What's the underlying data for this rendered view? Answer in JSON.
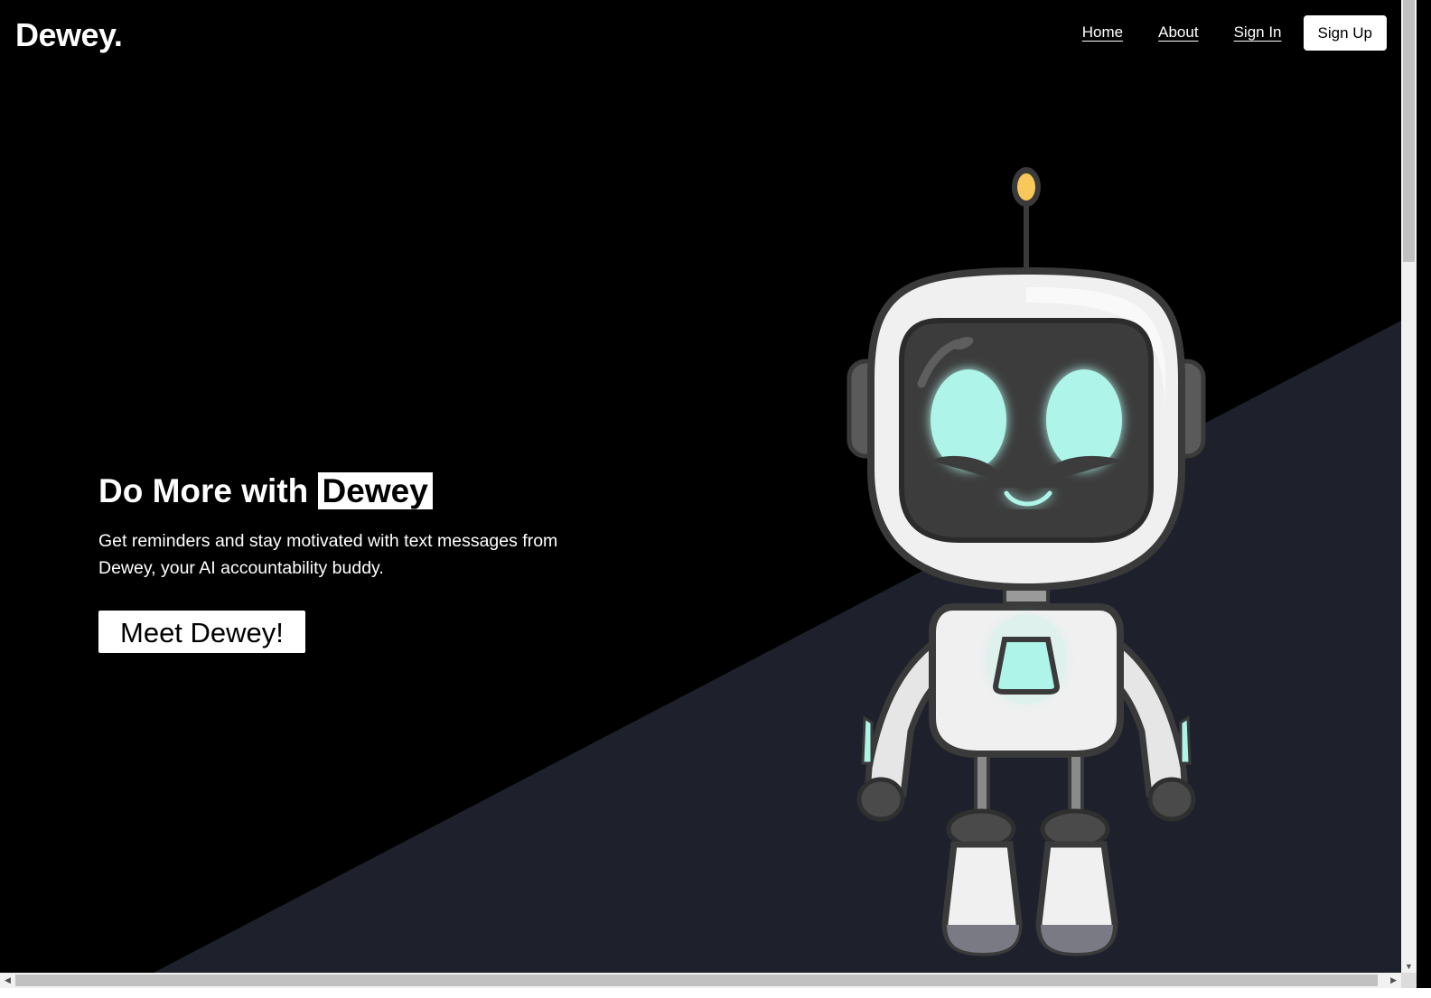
{
  "brand": {
    "logo_text": "Dewey."
  },
  "nav": {
    "links": [
      "Home",
      "About",
      "Sign In"
    ],
    "signup_label": "Sign Up"
  },
  "hero": {
    "title_prefix": "Do More with ",
    "title_highlight": "Dewey",
    "description": "Get reminders and stay motivated with text messages from Dewey, your AI accountability buddy.",
    "cta_label": "Meet Dewey!"
  },
  "illustration": {
    "name": "robot-mascot"
  },
  "colors": {
    "background": "#000000",
    "diagonal_panel": "#1e212b",
    "robot_eye": "#aef4e8",
    "antenna_bulb": "#f9c85a",
    "button_bg": "#ffffff"
  }
}
